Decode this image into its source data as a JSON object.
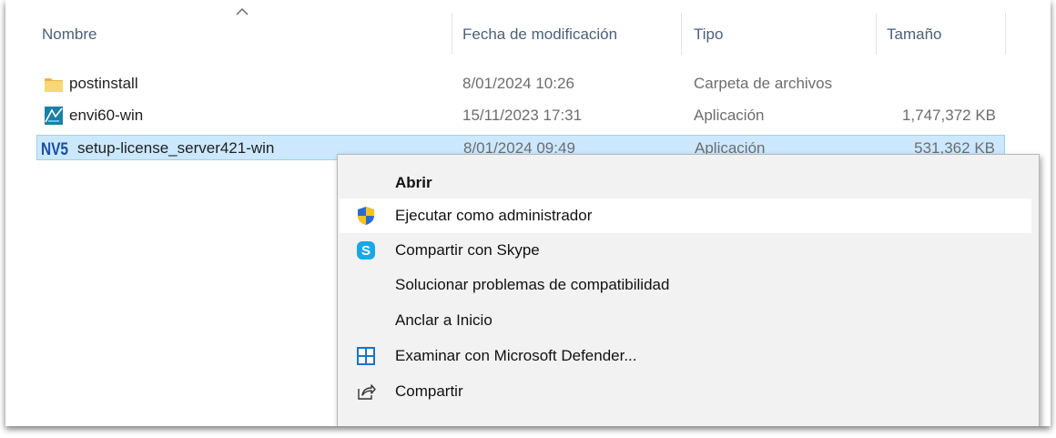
{
  "columns": {
    "name": "Nombre",
    "date": "Fecha de modificación",
    "type": "Tipo",
    "size": "Tamaño"
  },
  "files": [
    {
      "name": "postinstall",
      "date": "8/01/2024 10:26",
      "type": "Carpeta de archivos",
      "size": "",
      "icon": "folder-icon"
    },
    {
      "name": "envi60-win",
      "date": "15/11/2023 17:31",
      "type": "Aplicación",
      "size": "1,747,372 KB",
      "icon": "envi-app-icon"
    },
    {
      "name": "setup-license_server421-win",
      "date": "8/01/2024 09:49",
      "type": "Aplicación",
      "size": "531,362 KB",
      "icon": "nv5-app-icon",
      "selected": true
    }
  ],
  "context_menu": {
    "items": [
      {
        "label": "Abrir",
        "icon": ""
      },
      {
        "label": "Ejecutar como administrador",
        "icon": "uac-shield-icon"
      },
      {
        "label": "Compartir con Skype",
        "icon": "skype-icon"
      },
      {
        "label": "Solucionar problemas de compatibilidad",
        "icon": ""
      },
      {
        "label": "Anclar a Inicio",
        "icon": ""
      },
      {
        "label": "Examinar con Microsoft Defender...",
        "icon": "defender-icon"
      },
      {
        "label": "Compartir",
        "icon": "share-icon"
      }
    ]
  },
  "colors": {
    "selection": "#cce8ff",
    "selection_border": "#99d1ff",
    "header_text": "#4c607a",
    "menu_bg": "#f2f2f2"
  }
}
